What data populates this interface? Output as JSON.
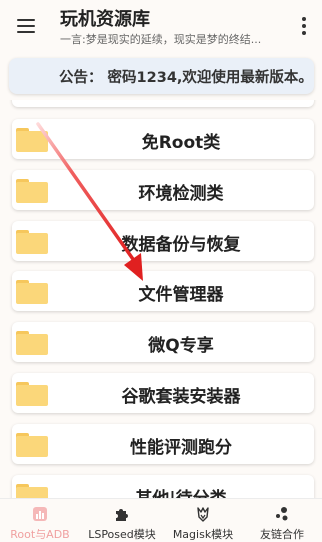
{
  "header": {
    "title": "玩机资源库",
    "subtitle": "一言:梦是现实的延续，现实是梦的终结..."
  },
  "notice": {
    "text": "公告：  密码1234,欢迎使用最新版本。"
  },
  "categories": [
    {
      "label": "免Root类"
    },
    {
      "label": "环境检测类"
    },
    {
      "label": "数据备份与恢复"
    },
    {
      "label": "文件管理器"
    },
    {
      "label": "微Q专享"
    },
    {
      "label": "谷歌套装安装器"
    },
    {
      "label": "性能评测跑分"
    },
    {
      "label": "其他|待分类"
    }
  ],
  "bottom_nav": [
    {
      "label": "Root与ADB",
      "icon": "chart-icon",
      "active": true
    },
    {
      "label": "LSPosed模块",
      "icon": "puzzle-icon",
      "active": false
    },
    {
      "label": "Magisk模块",
      "icon": "magisk-icon",
      "active": false
    },
    {
      "label": "友链合作",
      "icon": "link-dots-icon",
      "active": false
    }
  ],
  "colors": {
    "folder": "#fbd77a",
    "active_nav": "#f0a0a0",
    "arrow": "#e02020",
    "notice_bg": "#eaf0f8"
  }
}
